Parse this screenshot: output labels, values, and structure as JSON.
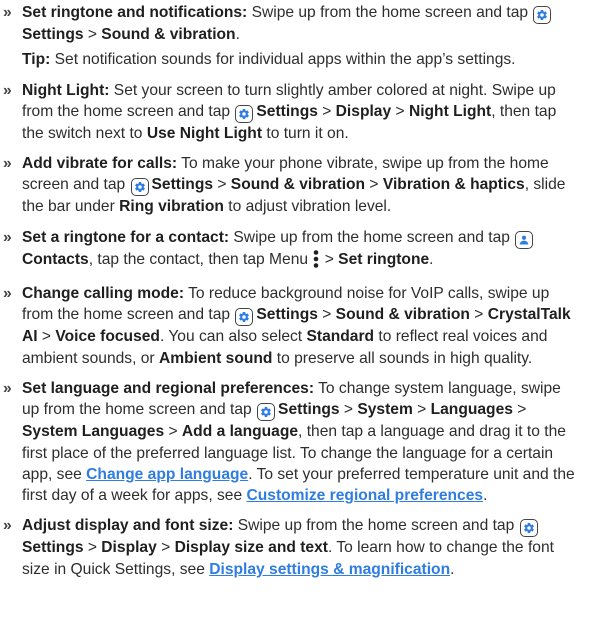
{
  "bullet_glyph": "»",
  "icons": {
    "settings": "settings-gear-icon",
    "contacts": "contacts-person-icon",
    "menu": "menu-vertical-dots-icon",
    "accent_color": "#2f7de1"
  },
  "ringtone_notifications": {
    "title": "Set ringtone and notifications:",
    "t1": " Swipe up from the home screen and tap ",
    "settings": "Settings",
    "sep1": " > ",
    "sound": "Sound & vibration",
    "end": "."
  },
  "tip": {
    "label": "Tip:",
    "text": " Set notification sounds for individual apps within the app’s settings."
  },
  "night_light": {
    "title": "Night Light:",
    "t1": " Set your screen to turn slightly amber colored at night. Swipe up from the home screen and tap ",
    "settings": "Settings",
    "sep1": " > ",
    "display": "Display",
    "sep2": " > ",
    "night": "Night Light",
    "t2": ", then tap the switch next to ",
    "use": "Use Night Light",
    "t3": " to turn it on."
  },
  "vibrate": {
    "title": "Add vibrate for calls:",
    "t1": " To make your phone vibrate, swipe up from the home screen and tap ",
    "settings": "Settings",
    "sep1": " > ",
    "sound": "Sound & vibration",
    "sep2": " > ",
    "haptics": "Vibration & haptics",
    "t2": ", slide the bar under ",
    "ring": "Ring vibration",
    "t3": " to adjust vibration level."
  },
  "contact_ringtone": {
    "title": "Set a ringtone for a contact:",
    "t1": " Swipe up from the home screen and tap ",
    "contacts": "Contacts",
    "t2": ", tap the contact, then tap Menu ",
    "sep1": " > ",
    "set": "Set ringtone",
    "end": "."
  },
  "calling_mode": {
    "title": "Change calling mode:",
    "t1": " To reduce background noise for VoIP calls, swipe up from the home screen and tap ",
    "settings": "Settings",
    "sep1": " > ",
    "sound": "Sound & vibration",
    "sep2": " > ",
    "crystal": "CrystalTalk AI",
    "sep3": " > ",
    "voice": "Voice focused",
    "t2": ". You can also select ",
    "standard": "Standard",
    "t3": " to reflect real voices and ambient sounds, or ",
    "ambient": "Ambient sound",
    "t4": " to preserve all sounds in high quality."
  },
  "language": {
    "title": "Set language and regional preferences:",
    "t1": " To change system language, swipe up from the home screen and tap ",
    "settings": "Settings",
    "sep1": " > ",
    "system": "System",
    "sep2": " > ",
    "languages": "Languages",
    "sep3": " > ",
    "system_languages": "System Languages",
    "sep4": " > ",
    "add": "Add a language",
    "t2": ", then tap a language and drag it to the first place of the preferred language list. To change the language for a certain app, see ",
    "link1": "Change app language",
    "t3": ". To set your preferred temperature unit and the first day of a week for apps, see ",
    "link2": "Customize regional preferences",
    "end": "."
  },
  "display_font": {
    "title": "Adjust display and font size:",
    "t1": " Swipe up from the home screen and tap ",
    "settings": "Settings",
    "sep1": " > ",
    "display": "Display",
    "sep2": " > ",
    "size": "Display size and text",
    "t2": ". To learn how to change the font size in Quick Settings, see ",
    "link": "Display settings & magnification",
    "end": "."
  }
}
